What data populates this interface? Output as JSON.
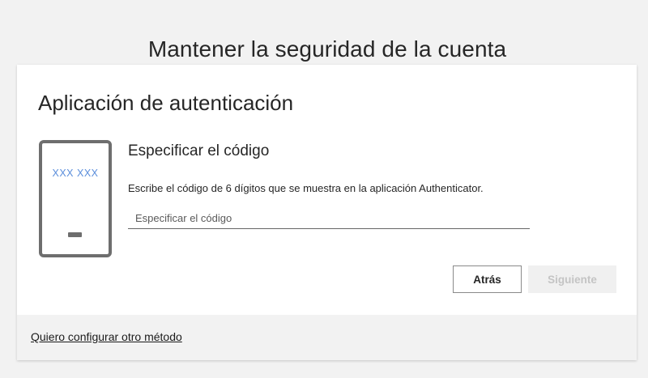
{
  "page": {
    "title": "Mantener la seguridad de la cuenta"
  },
  "card": {
    "heading": "Aplicación de autenticación",
    "phone_illustration": {
      "code_text": "XXX XXX",
      "code_color": "#5b8edb"
    },
    "sub_heading": "Especificar el código",
    "instructions": "Escribe el código de 6 dígitos que se muestra en la aplicación Authenticator.",
    "code_input": {
      "value": "",
      "placeholder": "Especificar el código"
    },
    "buttons": {
      "back_label": "Atrás",
      "next_label": "Siguiente",
      "next_disabled": true
    }
  },
  "footer": {
    "other_method_link": "Quiero configurar otro método"
  }
}
